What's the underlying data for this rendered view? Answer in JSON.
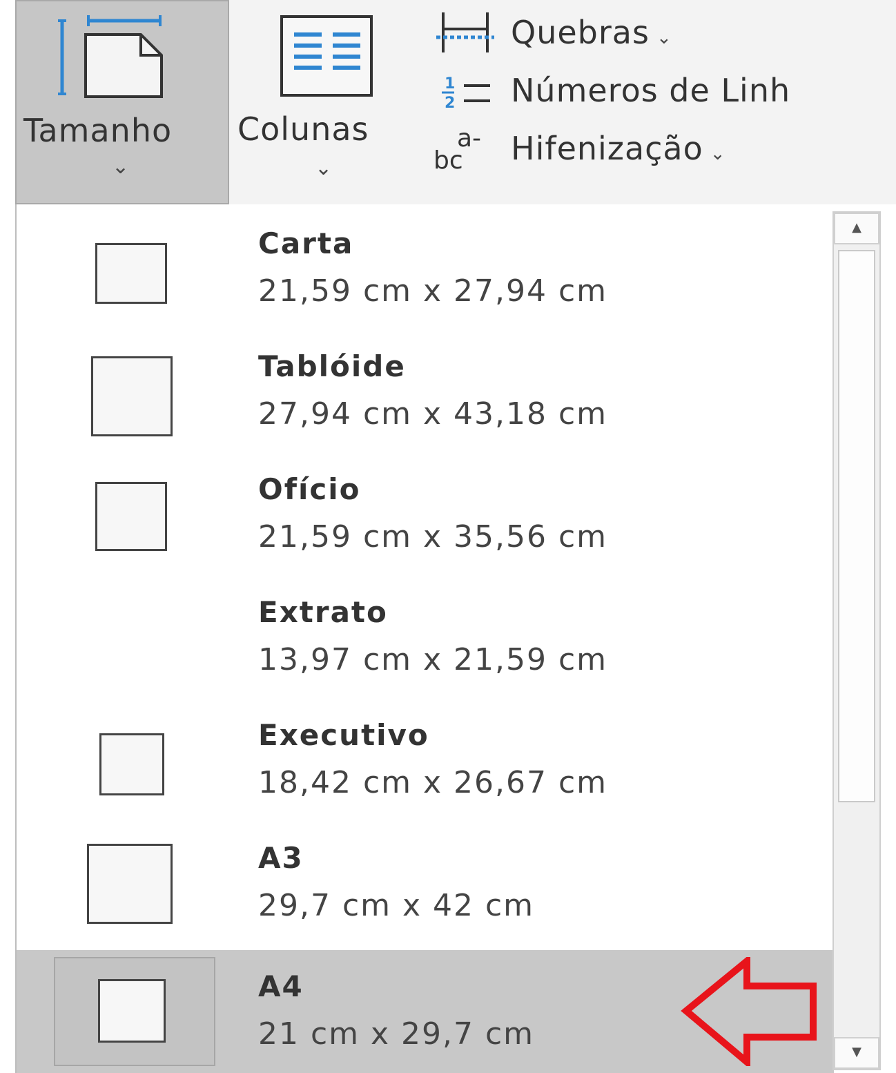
{
  "ribbon": {
    "tamanho_label": "Tamanho",
    "colunas_label": "Colunas",
    "quebras_label": "Quebras",
    "numeros_label": "Números de Linh",
    "hifenizacao_label": "Hifenização",
    "chevron_glyph": "⌄",
    "icons": {
      "tamanho": "page-size-icon",
      "colunas": "columns-icon",
      "quebras": "breaks-icon",
      "numeros": "line-numbers-icon",
      "hifenizacao": "hyphenation-icon"
    },
    "small_icon_text": {
      "num_top": "1",
      "num_bottom": "2",
      "hyph_top": "a-",
      "hyph_bottom": "bc"
    }
  },
  "sizes": [
    {
      "name": "Carta",
      "dims": "21,59 cm x 27,94 cm"
    },
    {
      "name": "Tablóide",
      "dims": "27,94 cm x 43,18 cm"
    },
    {
      "name": "Ofício",
      "dims": "21,59 cm x 35,56 cm"
    },
    {
      "name": "Extrato",
      "dims": "13,97 cm x 21,59 cm"
    },
    {
      "name": "Executivo",
      "dims": "18,42 cm x 26,67 cm"
    },
    {
      "name": "A3",
      "dims": "29,7 cm x 42 cm"
    },
    {
      "name": "A4",
      "dims": "21 cm x 29,7 cm",
      "selected": true
    }
  ],
  "scrollbar": {
    "up_glyph": "▲",
    "down_glyph": "▼"
  },
  "colors": {
    "selected_bg": "#c8c8c8",
    "ribbon_blue": "#2f86d1",
    "annotation_arrow": "#e8141b"
  }
}
